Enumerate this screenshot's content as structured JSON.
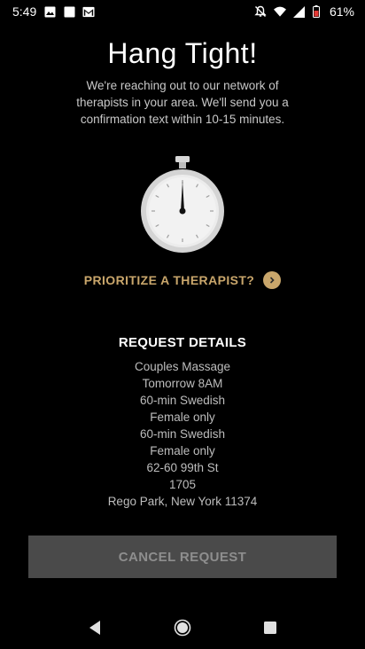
{
  "status_bar": {
    "time": "5:49",
    "battery": "61%",
    "left_icons": [
      "image-icon",
      "square-icon",
      "gmail-icon"
    ],
    "right_icons": [
      "silent-icon",
      "wifi-icon",
      "signal-icon",
      "battery-icon"
    ]
  },
  "header": {
    "title": "Hang Tight!",
    "subtitle": "We're reaching out to our network of therapists in your area. We'll send you a confirmation text within 10-15 minutes."
  },
  "prioritize": {
    "label": "PRIORITIZE A THERAPIST?",
    "icon": "chevron-right-icon"
  },
  "request_details": {
    "title": "REQUEST DETAILS",
    "lines": [
      "Couples Massage",
      "Tomorrow 8AM",
      "60-min Swedish",
      "Female only",
      "60-min Swedish",
      "Female only",
      "62-60 99th St",
      "1705",
      "Rego Park, New York 11374"
    ]
  },
  "cancel_button": {
    "label": "CANCEL REQUEST"
  },
  "nav_bar": {
    "buttons": [
      "back-icon",
      "home-icon",
      "recents-icon"
    ]
  },
  "colors": {
    "background": "#000000",
    "accent_gold": "#c9a66b",
    "button_bg": "#4a4a4a",
    "button_text": "#8e8e8e"
  }
}
